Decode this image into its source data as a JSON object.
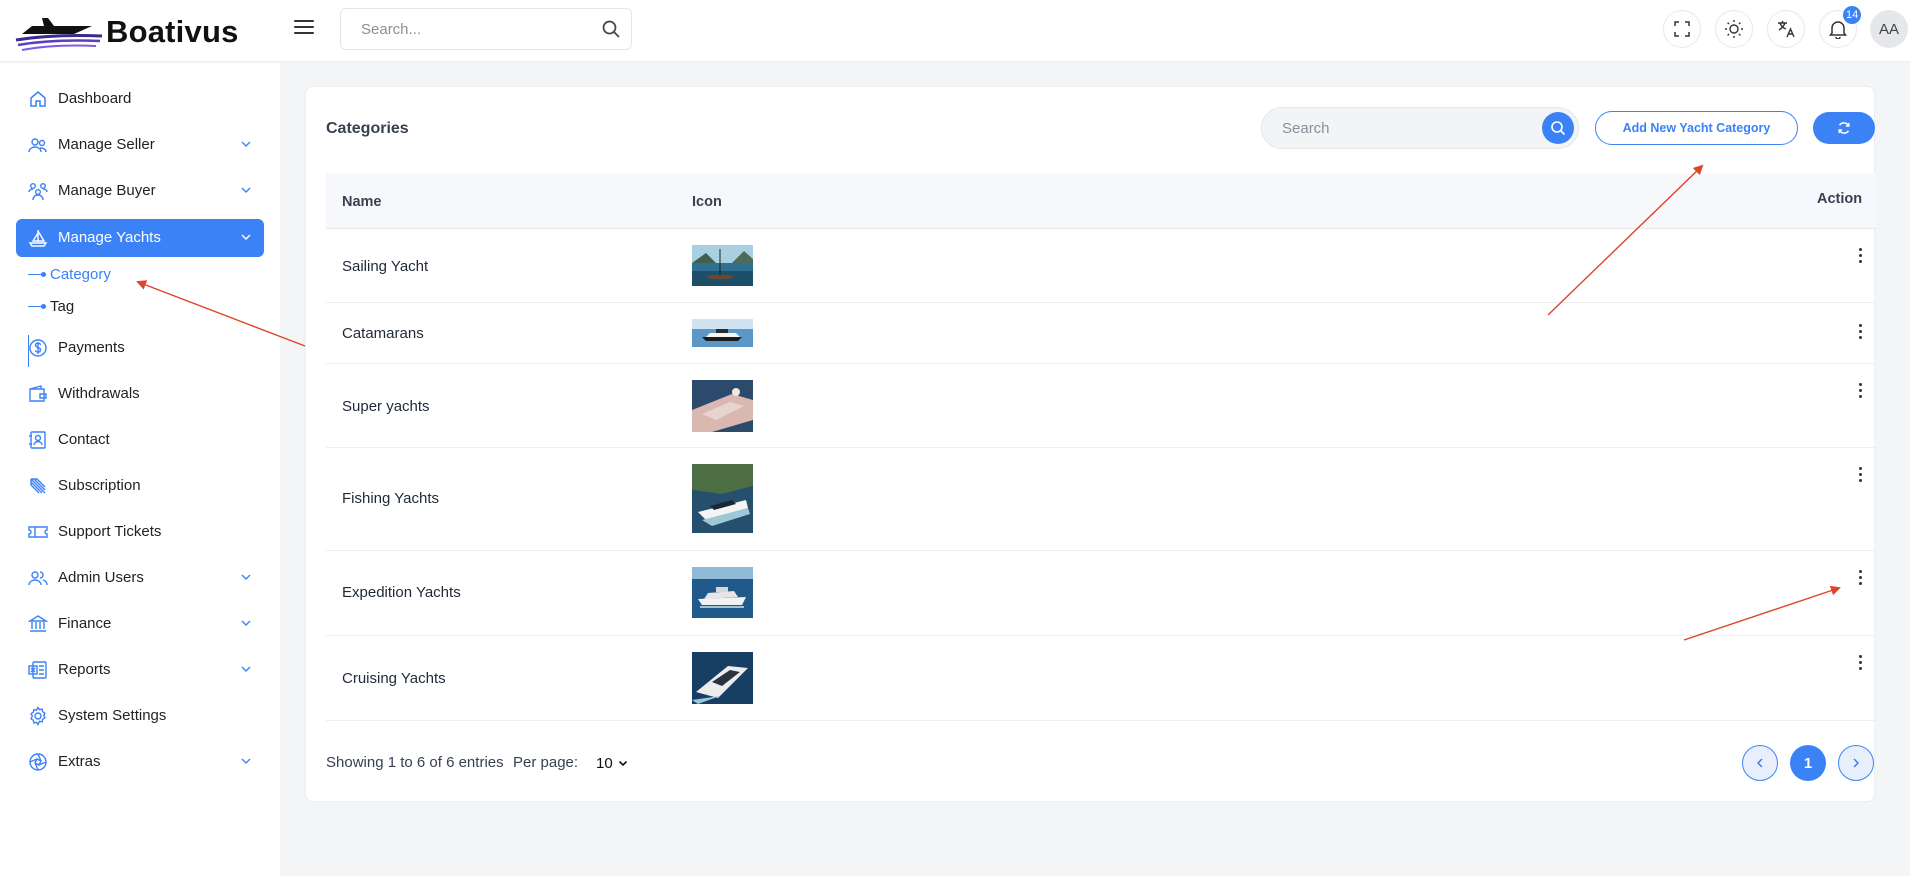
{
  "app": {
    "logo_text": "Boativus",
    "top_search_placeholder": "Search...",
    "notifications_count": "14",
    "avatar_initials": "AA"
  },
  "sidebar": {
    "items": [
      {
        "label": "Dashboard",
        "icon": "home-icon",
        "has_chevron": false
      },
      {
        "label": "Manage Seller",
        "icon": "users-icon",
        "has_chevron": true
      },
      {
        "label": "Manage Buyer",
        "icon": "group-icon",
        "has_chevron": true
      },
      {
        "label": "Manage Yachts",
        "icon": "sailboat-icon",
        "has_chevron": true,
        "active": true
      },
      {
        "label": "Payments",
        "icon": "dollar-icon",
        "has_chevron": false
      },
      {
        "label": "Withdrawals",
        "icon": "wallet-icon",
        "has_chevron": false
      },
      {
        "label": "Contact",
        "icon": "contact-icon",
        "has_chevron": false
      },
      {
        "label": "Subscription",
        "icon": "subscription-icon",
        "has_chevron": false
      },
      {
        "label": "Support Tickets",
        "icon": "ticket-icon",
        "has_chevron": false
      },
      {
        "label": "Admin Users",
        "icon": "admin-users-icon",
        "has_chevron": true
      },
      {
        "label": "Finance",
        "icon": "bank-icon",
        "has_chevron": true
      },
      {
        "label": "Reports",
        "icon": "report-icon",
        "has_chevron": true
      },
      {
        "label": "System Settings",
        "icon": "gear-icon",
        "has_chevron": false
      },
      {
        "label": "Extras",
        "icon": "aperture-icon",
        "has_chevron": true
      }
    ],
    "subitems": [
      {
        "label": "Category",
        "active": true
      },
      {
        "label": "Tag",
        "active": false
      }
    ]
  },
  "card": {
    "title": "Categories",
    "search_placeholder": "Search",
    "add_button_label": "Add New Yacht Category",
    "table": {
      "columns": [
        "Name",
        "Icon",
        "Action"
      ],
      "rows": [
        {
          "name": "Sailing Yacht",
          "thumb": "sailing-yacht-thumbnail"
        },
        {
          "name": "Catamarans",
          "thumb": "catamaran-thumbnail"
        },
        {
          "name": "Super yachts",
          "thumb": "super-yacht-thumbnail"
        },
        {
          "name": "Fishing Yachts",
          "thumb": "fishing-yacht-thumbnail"
        },
        {
          "name": "Expedition Yachts",
          "thumb": "expedition-yacht-thumbnail"
        },
        {
          "name": "Cruising Yachts",
          "thumb": "cruising-yacht-thumbnail"
        }
      ]
    },
    "footer": {
      "entries_text": "Showing 1 to 6 of 6 entries",
      "per_page_label": "Per page:",
      "per_page_value": "10",
      "current_page": "1"
    }
  },
  "colors": {
    "accent": "#3b82f6",
    "annotation": "#e0442a"
  }
}
